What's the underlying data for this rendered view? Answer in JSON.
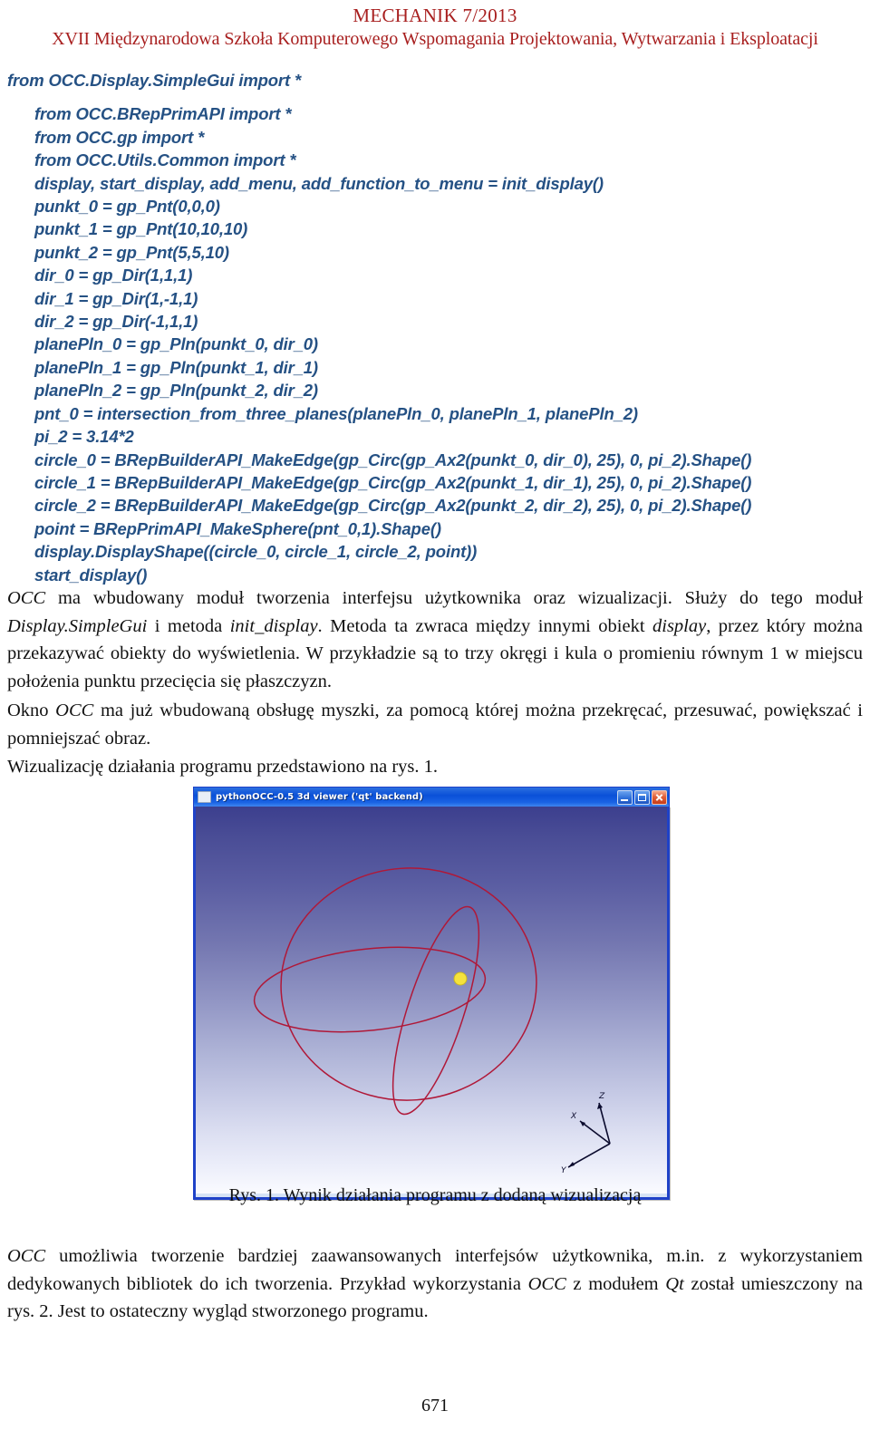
{
  "header": {
    "journal": "MECHANIK 7/2013",
    "conference": "XVII Międzynarodowa Szkoła Komputerowego Wspomagania Projektowania, Wytwarzania i Eksploatacji"
  },
  "code": {
    "language": "python",
    "color": "#255184",
    "lines": [
      "from OCC.Display.SimpleGui import *",
      "",
      "from OCC.BRepPrimAPI import *",
      "from OCC.gp import *",
      "from OCC.Utils.Common import *",
      "display, start_display, add_menu, add_function_to_menu = init_display()",
      "punkt_0 = gp_Pnt(0,0,0)",
      "punkt_1 = gp_Pnt(10,10,10)",
      "punkt_2 = gp_Pnt(5,5,10)",
      "dir_0 = gp_Dir(1,1,1)",
      "dir_1 = gp_Dir(1,-1,1)",
      "dir_2 = gp_Dir(-1,1,1)",
      "planePln_0 = gp_Pln(punkt_0, dir_0)",
      "planePln_1 = gp_Pln(punkt_1, dir_1)",
      "planePln_2 = gp_Pln(punkt_2, dir_2)",
      "pnt_0 = intersection_from_three_planes(planePln_0, planePln_1, planePln_2)",
      "pi_2 = 3.14*2",
      "circle_0 = BRepBuilderAPI_MakeEdge(gp_Circ(gp_Ax2(punkt_0, dir_0), 25), 0, pi_2).Shape()",
      "circle_1 = BRepBuilderAPI_MakeEdge(gp_Circ(gp_Ax2(punkt_1, dir_1), 25), 0, pi_2).Shape()",
      "circle_2 = BRepBuilderAPI_MakeEdge(gp_Circ(gp_Ax2(punkt_2, dir_2), 25), 0, pi_2).Shape()",
      "point = BRepPrimAPI_MakeSphere(pnt_0,1).Shape()",
      "display.DisplayShape((circle_0, circle_1, circle_2, point))",
      "start_display()"
    ]
  },
  "paragraphs": {
    "p1_html": "<i>OCC</i> ma wbudowany moduł tworzenia interfejsu użytkownika oraz wizualizacji. Służy do tego moduł <i>Display.SimpleGui</i> i metoda <i>init_display</i>. Metoda ta zwraca między innymi obiekt <i>display</i>, przez który można przekazywać obiekty do wyświetlenia. W przykładzie są to trzy okręgi i kula o promieniu równym 1 w miejscu położenia punktu przecięcia się płaszczyzn.",
    "p2_html": "Okno <i>OCC</i> ma już wbudowaną obsługę myszki, za pomocą której można przekręcać, przesuwać, powiększać i pomniejszać obraz.",
    "p3_html": "Wizualizację działania programu przedstawiono na rys. 1.",
    "p4_html": "<i>OCC</i> umożliwia tworzenie bardziej zaawansowanych interfejsów użytkownika, m.in. z wykorzystaniem dedykowanych bibliotek do ich tworzenia. Przykład wykorzystania <i>OCC</i> z modułem <i>Qt</i> został umieszczony na rys. 2. Jest to ostateczny wygląd stworzonego programu."
  },
  "figure": {
    "window_title": "pythonOCC-0.5 3d viewer ('qt' backend)",
    "window_buttons": [
      "minimize",
      "maximize",
      "close"
    ],
    "caption": "Rys. 1. Wynik działania programu z dodaną wizualizacją",
    "viewport": {
      "background_gradient": [
        "#3c3f8e",
        "#fafbff"
      ],
      "curve_color": "#b01838",
      "point_color": "#f5e23c",
      "axis_labels": [
        "X",
        "Y",
        "Z"
      ],
      "shapes": [
        "circle_0",
        "circle_1",
        "circle_2",
        "point"
      ]
    }
  },
  "footer": {
    "page_number": "671"
  }
}
